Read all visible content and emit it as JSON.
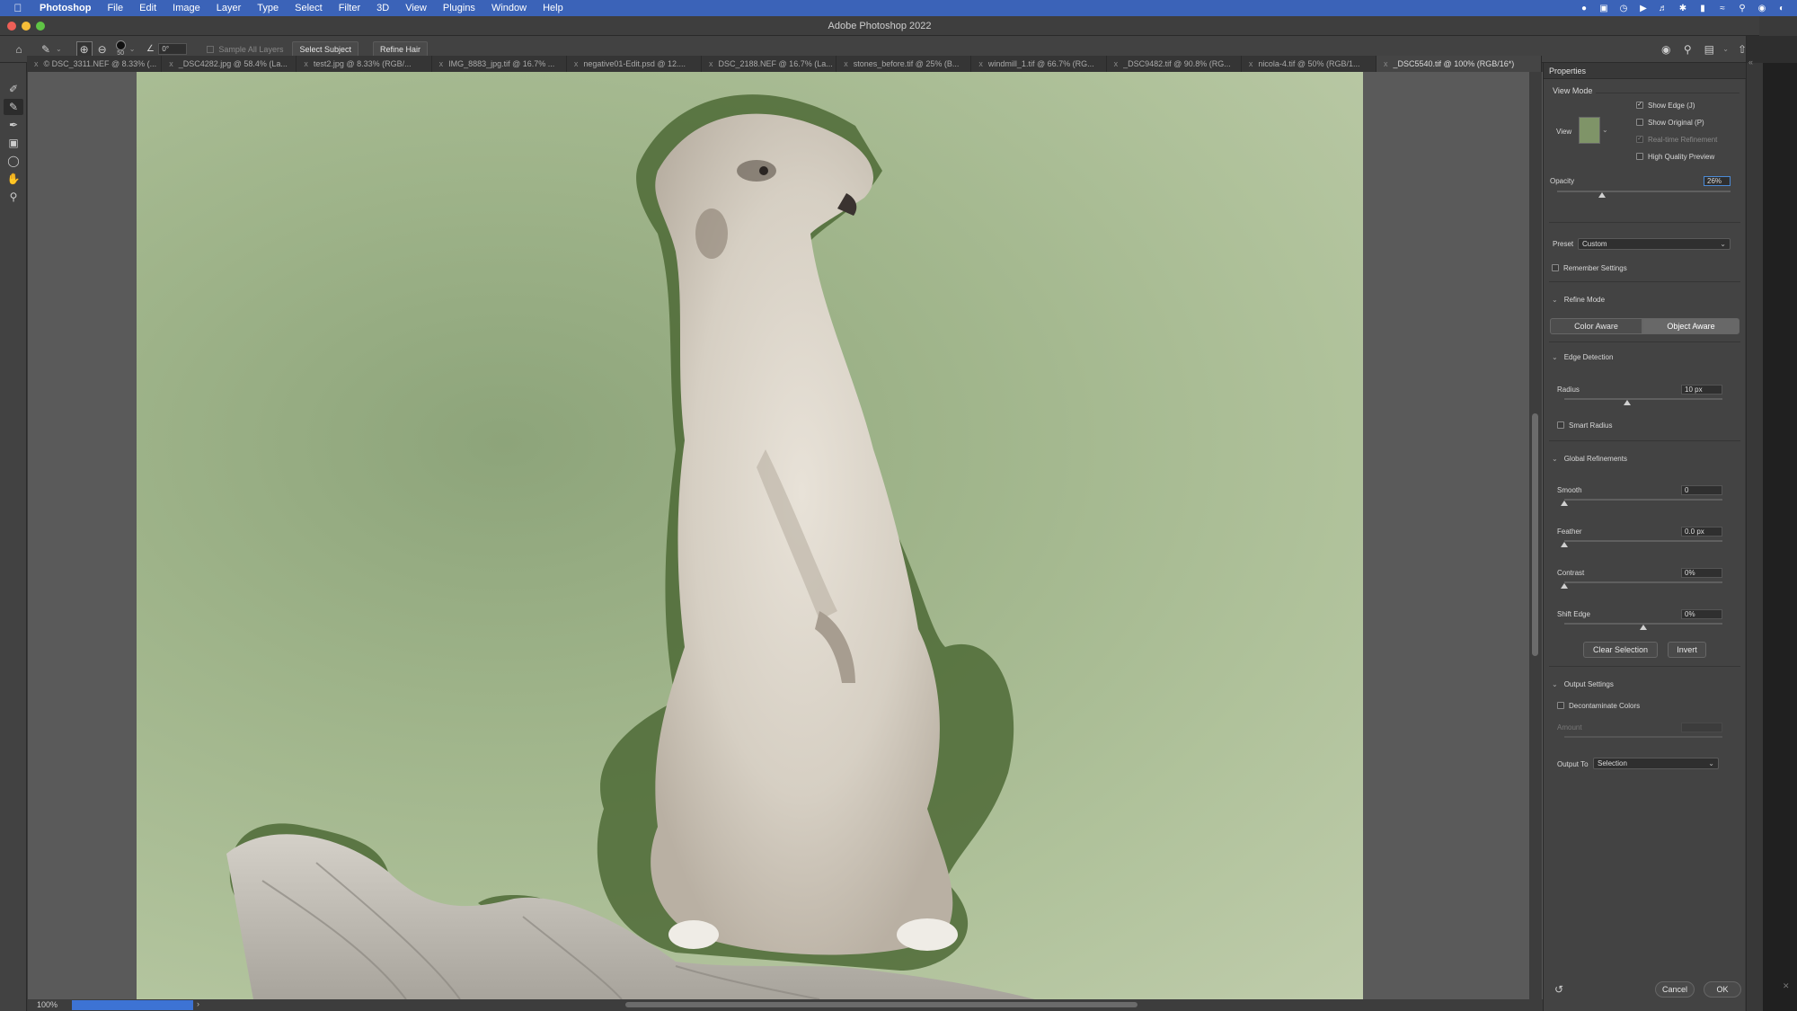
{
  "menubar": {
    "app_name": "Photoshop",
    "items": [
      "File",
      "Edit",
      "Image",
      "Layer",
      "Type",
      "Select",
      "Filter",
      "3D",
      "View",
      "Plugins",
      "Window",
      "Help"
    ]
  },
  "window": {
    "title": "Adobe Photoshop 2022"
  },
  "options_bar": {
    "brush_size": "50",
    "angle": "0°",
    "sample_all_layers": "Sample All Layers",
    "select_subject": "Select Subject",
    "refine_hair": "Refine Hair"
  },
  "tabs": [
    "© DSC_3311.NEF @ 8.33% (...",
    "_DSC4282.jpg @ 58.4% (La...",
    "test2.jpg @ 8.33% (RGB/...",
    "IMG_8883_jpg.tif @ 16.7% ...",
    "negative01-Edit.psd @ 12....",
    "DSC_2188.NEF @ 16.7% (La...",
    "stones_before.tif @ 25% (B...",
    "windmill_1.tif @ 66.7% (RG...",
    "_DSC9482.tif @ 90.8% (RG...",
    "nicola-4.tif @ 50% (RGB/1...",
    "_DSC5540.tif @ 100% (RGB/16*)"
  ],
  "status": {
    "zoom": "100%"
  },
  "properties": {
    "panel_title": "Properties",
    "view_mode": {
      "title": "View Mode",
      "view_label": "View",
      "show_edge": "Show Edge (J)",
      "show_original": "Show Original (P)",
      "realtime_refinement": "Real-time Refinement",
      "high_quality_preview": "High Quality Preview"
    },
    "opacity": {
      "label": "Opacity",
      "value": "26%",
      "level": 0.26
    },
    "preset": {
      "label": "Preset",
      "value": "Custom"
    },
    "remember_settings": "Remember Settings",
    "refine_mode": {
      "title": "Refine Mode",
      "color_aware": "Color Aware",
      "object_aware": "Object Aware"
    },
    "edge_detection": {
      "title": "Edge Detection",
      "radius_label": "Radius",
      "radius_value": "10 px",
      "radius_level": 0.4,
      "smart_radius": "Smart Radius"
    },
    "global_refinements": {
      "title": "Global Refinements",
      "smooth_label": "Smooth",
      "smooth_value": "0",
      "feather_label": "Feather",
      "feather_value": "0.0 px",
      "contrast_label": "Contrast",
      "contrast_value": "0%",
      "shift_edge_label": "Shift Edge",
      "shift_edge_value": "0%",
      "clear_selection": "Clear Selection",
      "invert": "Invert"
    },
    "output_settings": {
      "title": "Output Settings",
      "decontaminate": "Decontaminate Colors",
      "amount_label": "Amount",
      "output_to_label": "Output To",
      "output_to_value": "Selection"
    },
    "cancel": "Cancel",
    "ok": "OK"
  },
  "colors": {
    "menubar": "#3b63b8",
    "panel": "#434343",
    "accent": "#3d73d4"
  }
}
